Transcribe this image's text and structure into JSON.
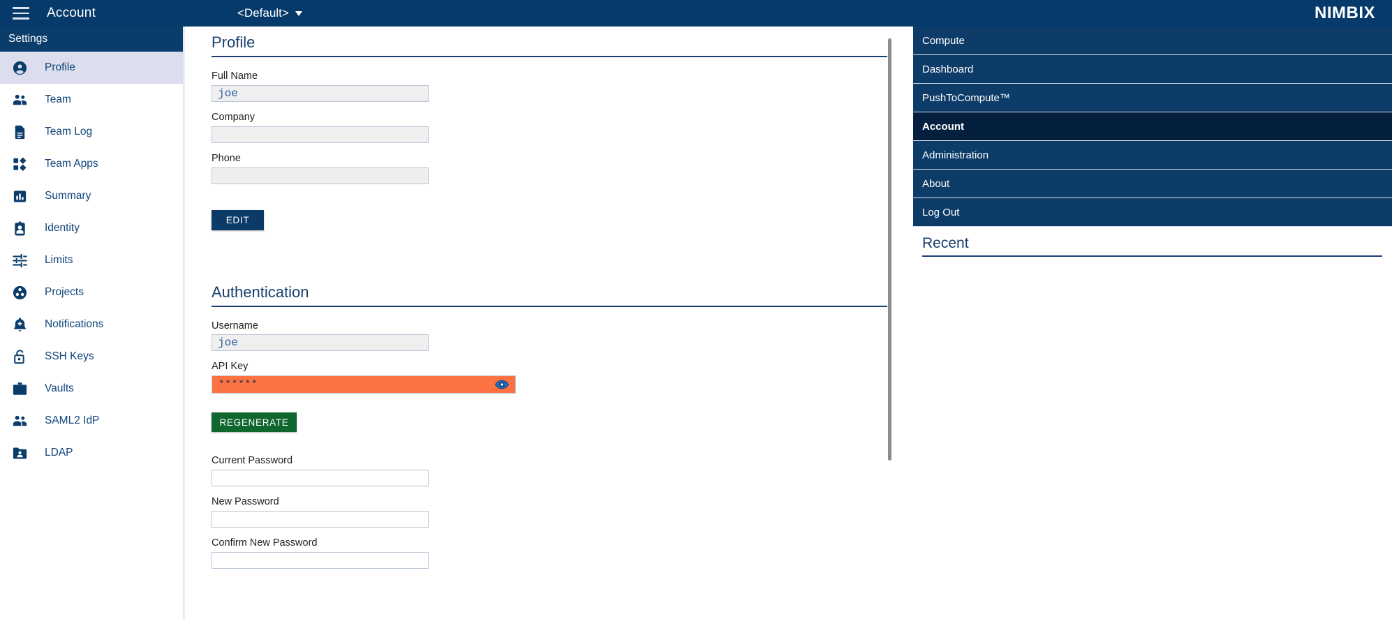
{
  "topbar": {
    "menu_icon": "hamburger-icon",
    "title": "Account",
    "context_selector": "<Default>",
    "brand": "NIMBIX"
  },
  "sidebar": {
    "header": "Settings",
    "items": [
      {
        "label": "Profile",
        "icon": "account-circle-icon",
        "active": true
      },
      {
        "label": "Team",
        "icon": "people-icon",
        "active": false
      },
      {
        "label": "Team Log",
        "icon": "document-icon",
        "active": false
      },
      {
        "label": "Team Apps",
        "icon": "apps-dashboard-icon",
        "active": false
      },
      {
        "label": "Summary",
        "icon": "bar-chart-icon",
        "active": false
      },
      {
        "label": "Identity",
        "icon": "id-badge-icon",
        "active": false
      },
      {
        "label": "Limits",
        "icon": "sliders-icon",
        "active": false
      },
      {
        "label": "Projects",
        "icon": "projects-circle-icon",
        "active": false
      },
      {
        "label": "Notifications",
        "icon": "bell-plus-icon",
        "active": false
      },
      {
        "label": "SSH Keys",
        "icon": "unlock-icon",
        "active": false
      },
      {
        "label": "Vaults",
        "icon": "briefcase-icon",
        "active": false
      },
      {
        "label": "SAML2 IdP",
        "icon": "people-icon",
        "active": false
      },
      {
        "label": "LDAP",
        "icon": "folder-user-icon",
        "active": false
      }
    ]
  },
  "main": {
    "profile": {
      "title": "Profile",
      "fields": [
        {
          "label": "Full Name",
          "value": "joe",
          "readonly": true
        },
        {
          "label": "Company",
          "value": "",
          "readonly": true
        },
        {
          "label": "Phone",
          "value": "",
          "readonly": true
        }
      ],
      "edit_button": "EDIT"
    },
    "authentication": {
      "title": "Authentication",
      "username": {
        "label": "Username",
        "value": "joe",
        "readonly": true
      },
      "api_key": {
        "label": "API Key",
        "masked_value": "******",
        "highlight_color": "#fc7242",
        "toggle_icon": "eye-visibility-icon"
      },
      "regenerate_button": "REGENERATE",
      "passwords": [
        {
          "label": "Current Password",
          "value": ""
        },
        {
          "label": "New Password",
          "value": ""
        },
        {
          "label": "Confirm New Password",
          "value": ""
        }
      ]
    }
  },
  "rightnav": {
    "items": [
      {
        "label": "Compute",
        "active": false
      },
      {
        "label": "Dashboard",
        "active": false
      },
      {
        "label": "PushToCompute™",
        "active": false
      },
      {
        "label": "Account",
        "active": true
      },
      {
        "label": "Administration",
        "active": false
      },
      {
        "label": "About",
        "active": false
      },
      {
        "label": "Log Out",
        "active": false
      }
    ],
    "recent_title": "Recent"
  },
  "colors": {
    "brand_navy": "#063a6b",
    "nav_navy": "#0d3c69",
    "active_navy": "#05203f",
    "accent_orange": "#fc7242",
    "regenerate_green": "#10662f",
    "sidebar_active": "#dcdeee"
  }
}
